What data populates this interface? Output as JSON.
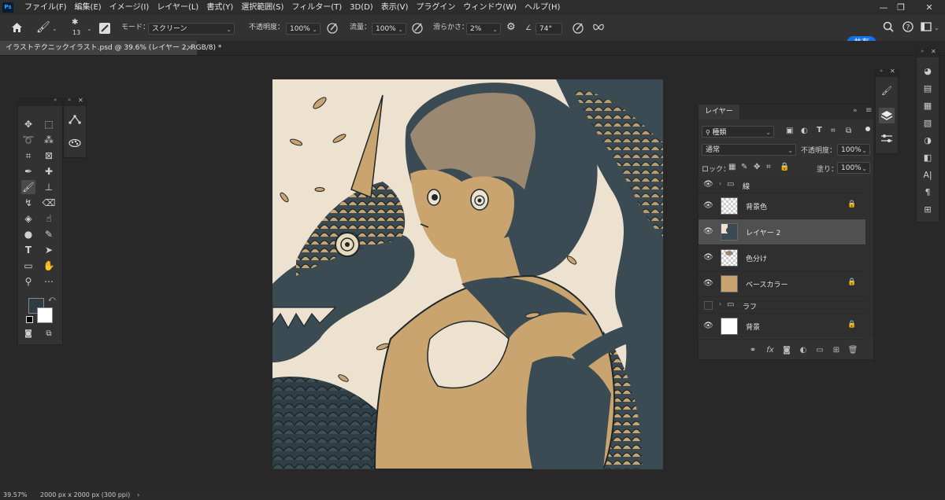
{
  "app": {
    "logo": "Ps"
  },
  "menu": [
    "ファイル(F)",
    "編集(E)",
    "イメージ(I)",
    "レイヤー(L)",
    "書式(Y)",
    "選択範囲(S)",
    "フィルター(T)",
    "3D(D)",
    "表示(V)",
    "プラグイン",
    "ウィンドウ(W)",
    "ヘルプ(H)"
  ],
  "window_controls": {
    "minimize": "—",
    "restore": "❐",
    "close": "✕"
  },
  "options": {
    "brush_size": "13",
    "mode_label": "モード：",
    "mode_value": "スクリーン",
    "opacity_label": "不透明度：",
    "opacity_value": "100%",
    "flow_label": "流量：",
    "flow_value": "100%",
    "smoothing_label": "滑らかさ：",
    "smoothing_value": "2%",
    "angle_value": "74°",
    "share_label": "共有"
  },
  "document_tab": {
    "title": "イラストテクニックイラスト.psd @ 39.6% (レイヤー 2, RGB/8) *",
    "close": "×"
  },
  "colors": {
    "foreground": "#2f3d43",
    "background": "#ffffff",
    "accent": "#1473e6"
  },
  "layers_panel": {
    "tab_label": "レイヤー",
    "filter_kind": "種類",
    "blend_mode": "通常",
    "opacity_label": "不透明度：",
    "opacity_value": "100%",
    "lock_label": "ロック：",
    "fill_label": "塗り：",
    "fill_value": "100%",
    "layers": [
      {
        "name": "線",
        "type": "group",
        "visible": true,
        "locked": false,
        "selected": false
      },
      {
        "name": "背景色",
        "type": "layer",
        "visible": true,
        "locked": true,
        "selected": false,
        "thumb": "checker"
      },
      {
        "name": "レイヤー 2",
        "type": "layer",
        "visible": true,
        "locked": false,
        "selected": true,
        "thumb": "art"
      },
      {
        "name": "色分け",
        "type": "layer",
        "visible": true,
        "locked": false,
        "selected": false,
        "thumb": "checker"
      },
      {
        "name": "ベースカラー",
        "type": "layer",
        "visible": true,
        "locked": true,
        "selected": false,
        "thumb": "tan"
      },
      {
        "name": "ラフ",
        "type": "group",
        "visible": false,
        "locked": false,
        "selected": false
      },
      {
        "name": "背景",
        "type": "layer",
        "visible": true,
        "locked": true,
        "selected": false,
        "thumb": "white"
      }
    ]
  },
  "status": {
    "zoom": "39.57%",
    "doc_size": "2000 px x 2000 px (300 ppi)",
    "arrow": "›"
  }
}
